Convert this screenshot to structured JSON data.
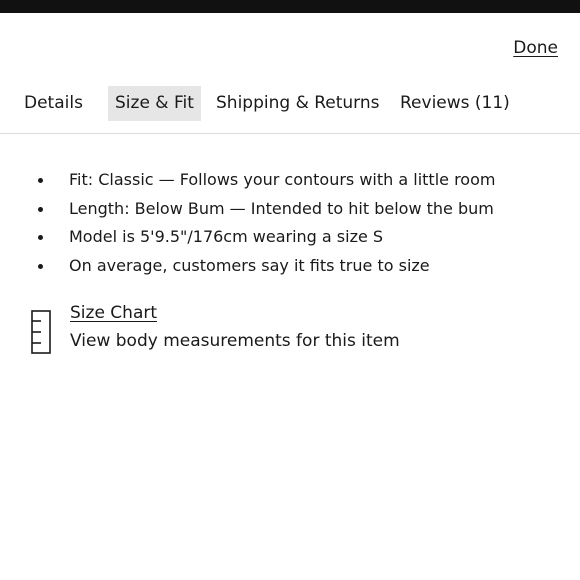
{
  "header": {
    "done_label": "Done"
  },
  "tabs": [
    {
      "label": "Details",
      "active": false
    },
    {
      "label": "Size & Fit",
      "active": true
    },
    {
      "label": "Shipping & Returns",
      "active": false
    },
    {
      "label": "Reviews (11)",
      "active": false
    }
  ],
  "fit_details": [
    "Fit: Classic — Follows your contours with a little room",
    "Length: Below Bum — Intended to hit below the bum",
    "Model is 5'9.5\"/176cm wearing a size S",
    "On average, customers say it fits true to size"
  ],
  "size_chart": {
    "icon": "ruler-icon",
    "link_label": "Size Chart",
    "description": "View body measurements for this item"
  },
  "colors": {
    "top_bar": "#111111",
    "active_tab_bg": "#e6e6e6",
    "divider": "#dcdcdc"
  }
}
